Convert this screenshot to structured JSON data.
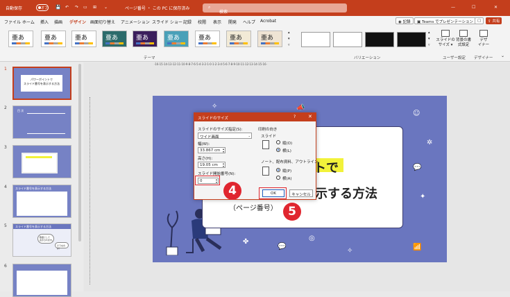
{
  "titlebar": {
    "autosave": "自動保存",
    "autosave_state": "オフ",
    "filename": "ページ番号 ・ この PC に保存済み",
    "search_placeholder": "検索",
    "controls": [
      "—",
      "☐",
      "✕"
    ]
  },
  "menu": {
    "tabs": [
      "ファイル",
      "ホーム",
      "挿入",
      "描画",
      "デザイン",
      "画面切り替え",
      "アニメーション",
      "スライド ショー",
      "記録",
      "校閲",
      "表示",
      "開発",
      "ヘルプ",
      "Acrobat"
    ],
    "active_tab": "デザイン",
    "record_button": "記録",
    "teams_button": "Teams でプレゼンテーション",
    "share_button": "共有"
  },
  "ribbon": {
    "theme_sample": "亜あ",
    "theme_group": "テーマ",
    "variant_group": "バリエーション",
    "slide_size": "スライドの\nサイズ ▾",
    "format_background": "背景の書\n式設定",
    "user_group": "ユーザー設定",
    "designer": "デザ\nイナー",
    "designer_group": "デザイナー"
  },
  "thumbnails": {
    "numbers": [
      "1",
      "2",
      "3",
      "4",
      "5",
      "6"
    ],
    "slide1_title": "パワーポイントで\nスライド番号を表示する方法",
    "slide2_title": "目 次",
    "slide4_title": "スライド番号を表示する方法",
    "slide5_title": "スライド番号を表示する方法",
    "slide5_bubble1": "数値として\n表示されます。",
    "slide5_bubble2": "そうなのか！"
  },
  "ruler": {
    "marks": "·16·15·14·13·12·11·10·9·8·7·6·5·4·3·2·1·0·1·2·3·4·5·6·7·8·9·10·11·12·13·14·15·16·"
  },
  "slide": {
    "title_line1": "ントで",
    "title_line2": "示する方法",
    "subtitle": "（ページ番号）"
  },
  "dialog": {
    "title": "スライドのサイズ",
    "help": "?",
    "close": "✕",
    "size_label": "スライドのサイズ指定(S):",
    "size_value": "ワイド画面",
    "width_label": "幅(W):",
    "width_value": "33.867 cm",
    "height_label": "高さ(H):",
    "height_value": "19.05 cm",
    "start_label": "スライド開始番号(N):",
    "start_value": "0",
    "orientation_label": "印刷の向き",
    "slide_group": "スライド",
    "portrait": "縦(O)",
    "landscape": "横(L)",
    "notes_group": "ノート、配布資料、アウトライン",
    "notes_portrait": "縦(P)",
    "notes_landscape": "横(A)",
    "ok": "OK",
    "cancel": "キャンセル"
  },
  "steps": {
    "step4": "4",
    "step5": "5"
  },
  "colors": {
    "accent": "#c43e1c",
    "slide_bg": "#6a76bf",
    "highlight_red": "#e0262f",
    "marker_yellow": "#f2f23a"
  }
}
